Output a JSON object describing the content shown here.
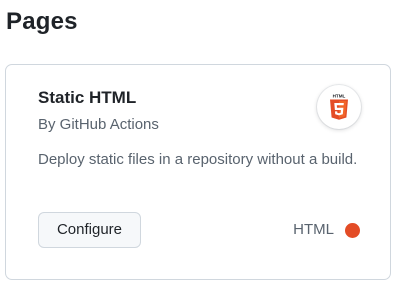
{
  "page": {
    "title": "Pages"
  },
  "card": {
    "title": "Static HTML",
    "byline": "By GitHub Actions",
    "description": "Deploy static files in a repository without a build.",
    "logo": {
      "icon": "html5-logo-icon",
      "badge_text": "HTML",
      "color": "#e44d26"
    },
    "configure_label": "Configure",
    "language": {
      "name": "HTML",
      "color": "#e34c26"
    }
  }
}
